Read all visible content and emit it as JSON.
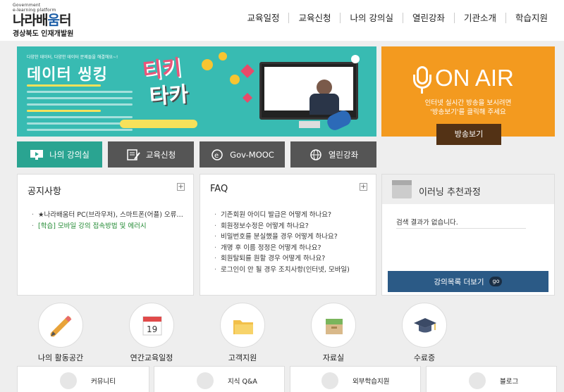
{
  "header": {
    "logo_small_1": "Government",
    "logo_small_2": "e-learning platform",
    "logo_text_a": "나라배",
    "logo_text_b": "움",
    "logo_text_c": "터",
    "org_name": "경상북도 인재개발원",
    "nav": [
      "교육일정",
      "교육신청",
      "나의 강의실",
      "열린강좌",
      "기관소개",
      "학습지원"
    ]
  },
  "banner": {
    "top_text": "다양한 데이터, 다양한 데이터 문제들을 해결해요~!",
    "title": "데이터 씽킹",
    "tiki": "티키",
    "taka": "타카"
  },
  "onair": {
    "title": "ON AIR",
    "desc_line1": "인터넷 실시간 방송을 보시려면",
    "desc_line2": "'방송보기'를 클릭해 주세요",
    "button": "방송보기"
  },
  "quick_buttons": [
    {
      "label": "나의 강의실",
      "icon": "monitor-icon"
    },
    {
      "label": "교육신청",
      "icon": "pencil-note-icon"
    },
    {
      "label": "Gov-MOOC",
      "icon": "e-globe-icon"
    },
    {
      "label": "열린강좌",
      "icon": "globe-icon"
    }
  ],
  "notice": {
    "title": "공지사항",
    "items": [
      "★나라배움터 PC(브라우저), 스마트폰(어플) 오류조치...",
      "[학습] 모바일 강의 접속방법 및 에러시"
    ]
  },
  "faq": {
    "title": "FAQ",
    "items": [
      "기존회원 아이디 발급은 어떻게 하나요?",
      "회원정보수정은 어떻게 하나요?",
      "비밀번호를 분실했을 경우 어떻게 하나요?",
      "개명 후 이름 정정은 어떻게 하나요?",
      "회원탈퇴를 원할 경우 어떻게 하나요?",
      "로그인이 안 될 경우 조치사항(인터넷, 모바일)"
    ]
  },
  "recommend": {
    "title": "이러닝 추천과정",
    "empty": "검색 결과가 없습니다.",
    "more": "강의목록 더보기",
    "go": "go"
  },
  "icon_menu": [
    {
      "label": "나의 활동공간",
      "icon": "pencil-icon"
    },
    {
      "label": "연간교육일정",
      "icon": "calendar-icon"
    },
    {
      "label": "고객지원",
      "icon": "folder-icon"
    },
    {
      "label": "자료실",
      "icon": "box-icon"
    },
    {
      "label": "수료증",
      "icon": "graduation-cap-icon"
    }
  ],
  "calendar_day": "19",
  "bottom_cards": [
    {
      "label": "커뮤니티",
      "icon": "chat-icon"
    },
    {
      "label": "지식 Q&A",
      "icon": "qa-icon"
    },
    {
      "label": "외부학습지원",
      "icon": "book-icon"
    },
    {
      "label": "블로그",
      "icon": "blog-icon"
    }
  ],
  "colors": {
    "teal": "#2aa491",
    "orange": "#f39a1f",
    "navy": "#2b5a86",
    "dark_button": "#555555"
  }
}
